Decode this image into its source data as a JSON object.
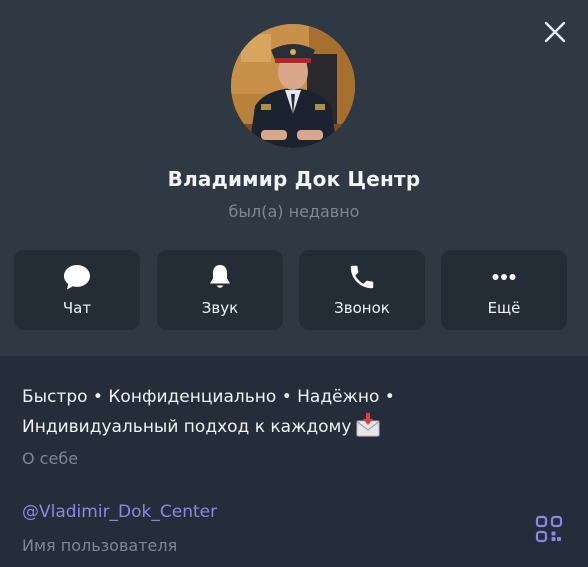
{
  "profile": {
    "name": "Владимир Док Центр",
    "status": "был(а) недавно"
  },
  "actions": [
    {
      "label": "Чат",
      "icon": "chat-bubble-icon"
    },
    {
      "label": "Звук",
      "icon": "bell-icon"
    },
    {
      "label": "Звонок",
      "icon": "phone-icon"
    },
    {
      "label": "Ещё",
      "icon": "more-dots-icon"
    }
  ],
  "info": {
    "bio_line1": "Быстро • Конфиденциально • Надёжно •",
    "bio_line2": "Индивидуальный подход к каждому",
    "bio_emoji": "incoming-envelope-icon",
    "bio_caption": "О себе",
    "username": "@Vladimir_Dok_Center",
    "username_caption": "Имя пользователя"
  },
  "icons": {
    "close": "close-icon",
    "qr": "qr-code-icon"
  },
  "colors": {
    "header_bg": "#2f3943",
    "body_bg": "#242d39",
    "button_bg": "#242d36",
    "muted_text": "#7d8793",
    "link": "#8d86e6"
  }
}
